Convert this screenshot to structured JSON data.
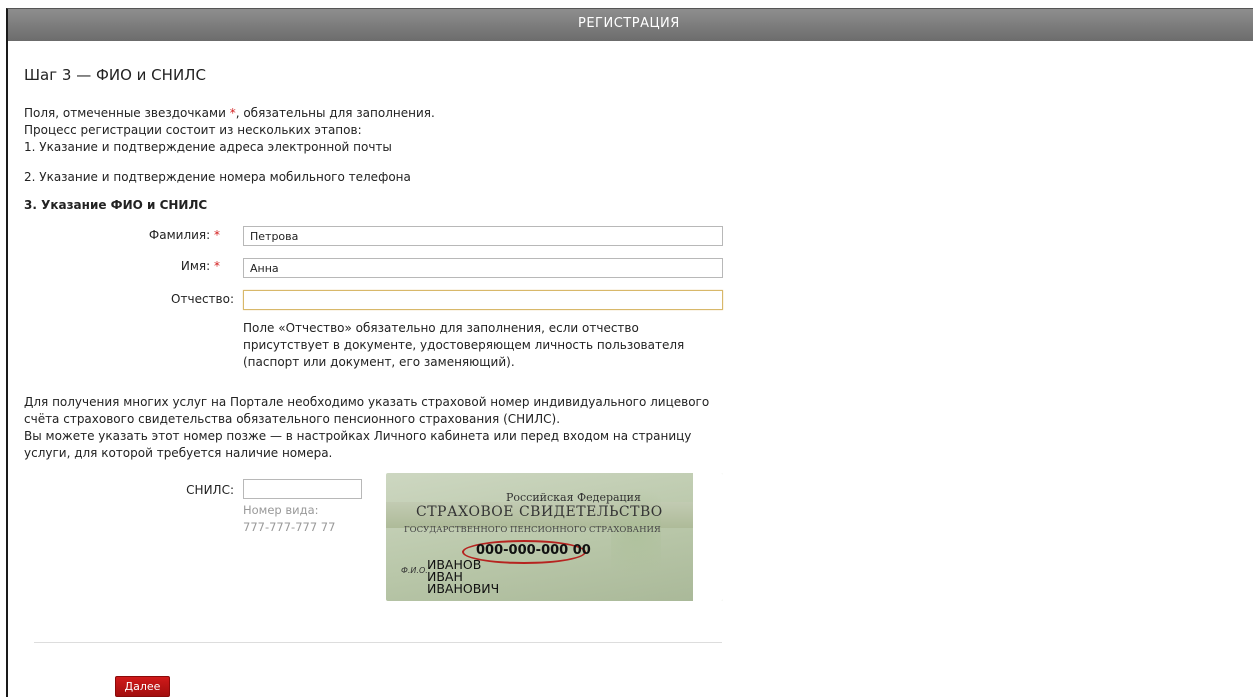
{
  "header": {
    "title": "РЕГИСТРАЦИЯ"
  },
  "page": {
    "step_title": "Шаг 3 — ФИО и СНИЛС",
    "required_note_before": "Поля, отмеченные звездочками ",
    "required_star": "*",
    "required_note_after": ", обязательны для заполнения.",
    "process_note": "Процесс регистрации состоит из нескольких этапов:"
  },
  "steps": [
    "1.  Указание и подтверждение адреса электронной почты",
    "2.  Указание и подтверждение номера мобильного телефона",
    "3.  Указание ФИО и СНИЛС"
  ],
  "form": {
    "surname_label": "Фамилия:",
    "surname_value": "Петрова",
    "name_label": "Имя:",
    "name_value": "Анна",
    "patronymic_label": "Отчество:",
    "patronymic_value": "",
    "required_star": "*",
    "patronymic_hint": "Поле «Отчество» обязательно для заполнения, если отчество присутствует в документе, удостоверяющем личность пользователя (паспорт или документ, его заменяющий).",
    "snils_info_1": "Для получения многих услуг на Портале необходимо указать страховой номер индивидуального лицевого счёта страхового свидетельства обязательного пенсионного страхования (СНИЛС).",
    "snils_info_2": "Вы можете указать этот номер позже — в настройках Личного кабинета или перед входом на страницу услуги, для которой требуется наличие номера.",
    "snils_label": "СНИЛС:",
    "snils_value": "",
    "snils_hint_title": "Номер вида:",
    "snils_hint_example": "777-777-777 77"
  },
  "card": {
    "country": "Российская Федерация",
    "title": "СТРАХОВОЕ СВИДЕТЕЛЬСТВО",
    "subtitle": "ГОСУДАРСТВЕННОГО ПЕНСИОННОГО СТРАХОВАНИЯ",
    "number": "000-000-000 00",
    "fio_label": "Ф.И.О.",
    "fio": [
      "ИВАНОВ",
      "ИВАН",
      "ИВАНОВИЧ"
    ]
  },
  "actions": {
    "next_label": "Далее"
  },
  "colors": {
    "accent_red": "#c8161d",
    "required_star": "#d32020",
    "header_gray": "#7b7b7b"
  }
}
